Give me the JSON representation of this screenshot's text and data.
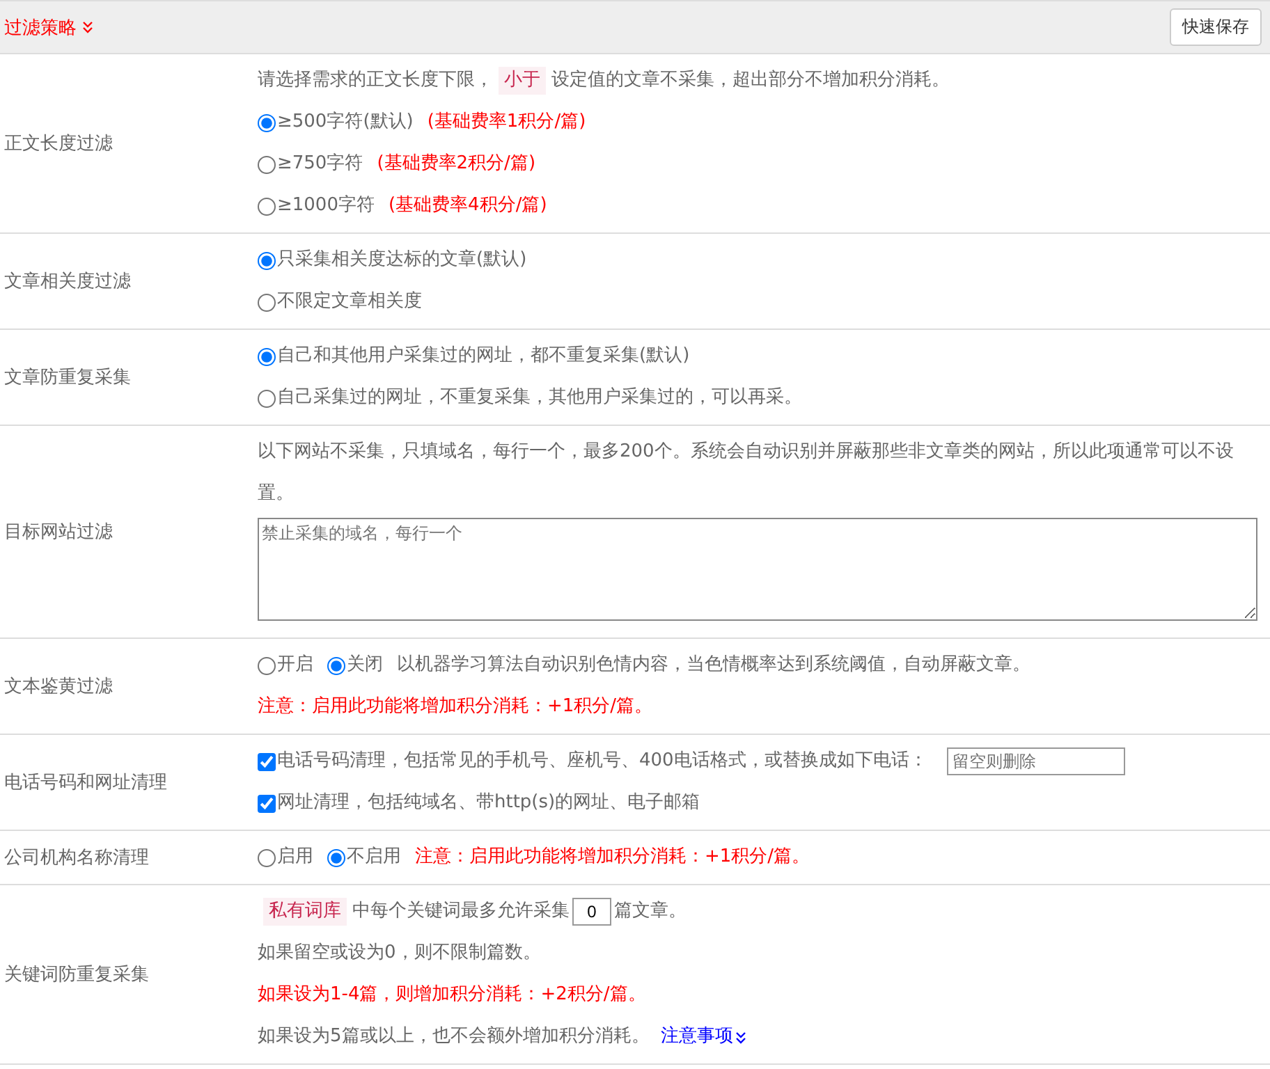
{
  "header": {
    "title": "过滤策略",
    "save_button": "快速保存"
  },
  "rows": [
    {
      "label": "正文长度过滤",
      "lines": [
        [
          {
            "kind": "text",
            "text": "请选择需求的正文长度下限，"
          },
          {
            "kind": "tag",
            "text": "小于"
          },
          {
            "kind": "text",
            "text": "设定值的文章不采集，超出部分不增加积分消耗。"
          }
        ],
        [
          {
            "kind": "radio",
            "text": "≥500字符(默认)",
            "selected": true
          },
          {
            "kind": "red",
            "text": "(基础费率1积分/篇)"
          }
        ],
        [
          {
            "kind": "radio",
            "text": "≥750字符",
            "selected": false
          },
          {
            "kind": "red",
            "text": "(基础费率2积分/篇)"
          }
        ],
        [
          {
            "kind": "radio",
            "text": "≥1000字符",
            "selected": false
          },
          {
            "kind": "red",
            "text": "(基础费率4积分/篇)"
          }
        ]
      ]
    },
    {
      "label": "文章相关度过滤",
      "lines": [
        [
          {
            "kind": "radio",
            "text": "只采集相关度达标的文章(默认)",
            "selected": true
          }
        ],
        [
          {
            "kind": "radio",
            "text": "不限定文章相关度",
            "selected": false
          }
        ]
      ]
    },
    {
      "label": "文章防重复采集",
      "lines": [
        [
          {
            "kind": "radio",
            "text": "自己和其他用户采集过的网址，都不重复采集(默认)",
            "selected": true
          }
        ],
        [
          {
            "kind": "radio",
            "text": "自己采集过的网址，不重复采集，其他用户采集过的，可以再采。",
            "selected": false
          }
        ]
      ]
    },
    {
      "label": "目标网站过滤",
      "lines": [
        [
          {
            "kind": "text",
            "text": "以下网站不采集，只填域名，每行一个，最多200个。系统会自动识别并屏蔽那些非文章类的网站，所以此项通常可以不设置。"
          }
        ],
        [
          {
            "kind": "textarea",
            "placeholder": "禁止采集的域名，每行一个"
          }
        ]
      ]
    },
    {
      "label": "文本鉴黄过滤",
      "lines": [
        [
          {
            "kind": "radio",
            "text": "开启",
            "selected": false
          },
          {
            "kind": "radio",
            "text": "关闭",
            "selected": true
          },
          {
            "kind": "text",
            "text": "以机器学习算法自动识别色情内容，当色情概率达到系统阈值，自动屏蔽文章。"
          }
        ],
        [
          {
            "kind": "red",
            "text": "注意：启用此功能将增加积分消耗：+1积分/篇。"
          }
        ]
      ]
    },
    {
      "label": "电话号码和网址清理",
      "lines": [
        [
          {
            "kind": "check",
            "text": "电话号码清理，包括常见的手机号、座机号、400电话格式，或替换成如下电话：",
            "checked": true
          },
          {
            "kind": "field",
            "placeholder": "留空则删除"
          }
        ],
        [
          {
            "kind": "check",
            "text": "网址清理，包括纯域名、带http(s)的网址、电子邮箱",
            "checked": true
          }
        ]
      ]
    },
    {
      "label": "公司机构名称清理",
      "lines": [
        [
          {
            "kind": "radio",
            "text": "启用",
            "selected": false
          },
          {
            "kind": "radio",
            "text": "不启用",
            "selected": true
          },
          {
            "kind": "red",
            "text": "注意：启用此功能将增加积分消耗：+1积分/篇。"
          }
        ]
      ]
    },
    {
      "label": "关键词防重复采集",
      "lines": [
        [
          {
            "kind": "tag",
            "text": "私有词库"
          },
          {
            "kind": "text",
            "text": "中每个关键词最多允许采集"
          },
          {
            "kind": "number",
            "value": "0"
          },
          {
            "kind": "text",
            "text": "篇文章。"
          }
        ],
        [
          {
            "kind": "text",
            "text": "如果留空或设为0，则不限制篇数。"
          }
        ],
        [
          {
            "kind": "red",
            "text": "如果设为1-4篇，则增加积分消耗：+2积分/篇。"
          }
        ],
        [
          {
            "kind": "text",
            "text": "如果设为5篇或以上，也不会额外增加积分消耗。"
          },
          {
            "kind": "link",
            "text": "注意事项"
          }
        ]
      ]
    }
  ]
}
